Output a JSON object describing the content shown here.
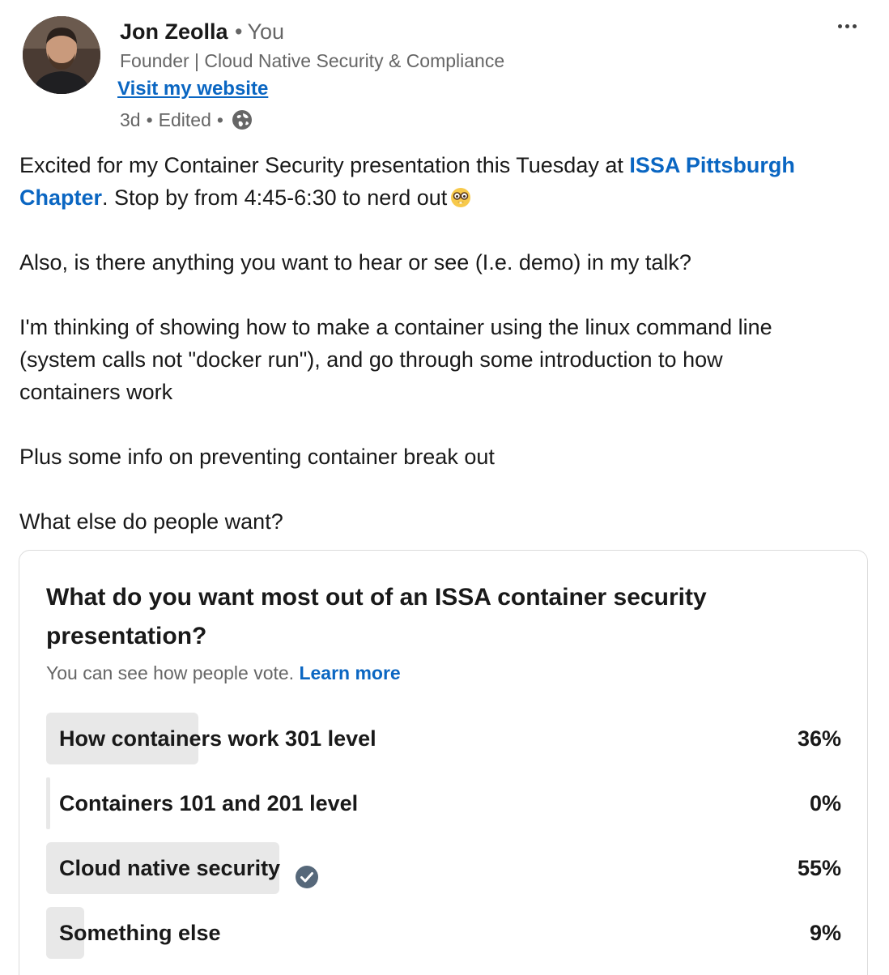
{
  "author": {
    "name": "Jon Zeolla",
    "relation": "You",
    "headline": "Founder | Cloud Native Security & Compliance",
    "website_label": "Visit my website",
    "age": "3d",
    "edited": "Edited",
    "visibility_icon": "globe-icon",
    "avatar_icon": "profile-photo"
  },
  "post": {
    "line1_pre": "Excited for my Container Security presentation this Tuesday at ",
    "mention_part1": "ISSA Pittsburgh",
    "mention_part2": "Chapter",
    "line2_post": ". Stop by from 4:45-6:30 to nerd out",
    "emoji": "nerd-face-emoji",
    "para2": "Also, is there anything you want to hear or see (I.e. demo) in my talk?",
    "para3_l1": "I'm thinking of showing how to make a container using the linux command line",
    "para3_l2": "(system calls not \"docker run\"), and go through some introduction to how",
    "para3_l3": "containers work",
    "para4": "Plus some info on preventing container break out",
    "para5": "What else do people want?"
  },
  "poll": {
    "question": "What do you want most out of an ISSA container security presentation?",
    "note": "You can see how people vote.",
    "learn_more": "Learn more",
    "options": [
      {
        "label": "How containers work 301 level",
        "percent_text": "36%",
        "percent": 36,
        "selected": false
      },
      {
        "label": "Containers 101 and 201 level",
        "percent_text": "0%",
        "percent": 0,
        "selected": false
      },
      {
        "label": "Cloud native security",
        "percent_text": "55%",
        "percent": 55,
        "selected": true
      },
      {
        "label": "Something else",
        "percent_text": "9%",
        "percent": 9,
        "selected": false
      }
    ],
    "bar_color": "#e8e8e8",
    "check_color": "#56687a"
  },
  "colors": {
    "link": "#0a66c2",
    "secondary_text": "#666666",
    "text": "#191919"
  }
}
